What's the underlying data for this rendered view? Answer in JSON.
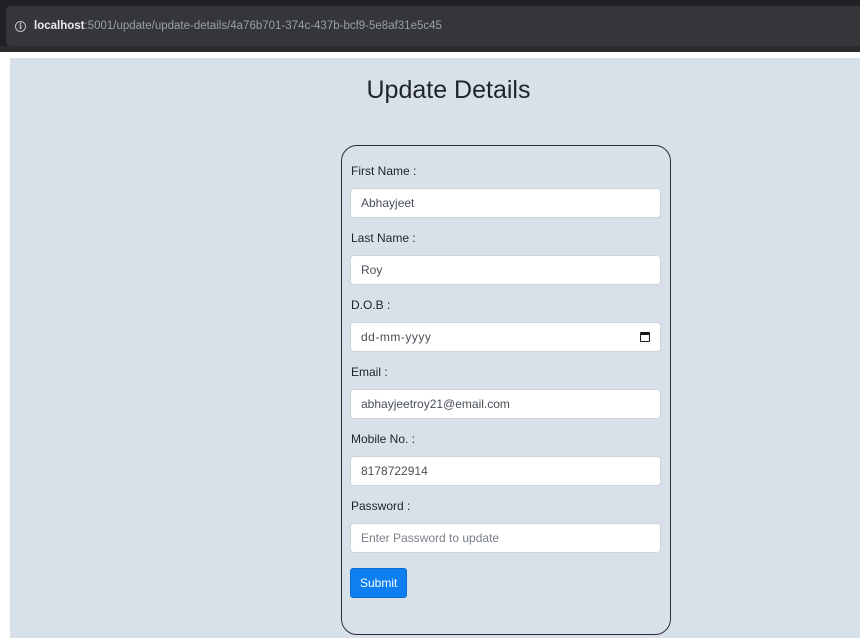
{
  "browser": {
    "url_host": "localhost",
    "url_path": ":5001/update/update-details/4a76b701-374c-437b-bcf9-5e8af31e5c45"
  },
  "page": {
    "title": "Update Details"
  },
  "form": {
    "first_name": {
      "label": "First Name :",
      "value": "Abhayjeet"
    },
    "last_name": {
      "label": "Last Name :",
      "value": "Roy"
    },
    "dob": {
      "label": "D.O.B :",
      "placeholder": "dd-mm-yyyy"
    },
    "email": {
      "label": "Email :",
      "value": "abhayjeetroy21@email.com"
    },
    "mobile": {
      "label": "Mobile No. :",
      "value": "8178722914"
    },
    "password": {
      "label": "Password :",
      "placeholder": "Enter Password to update"
    },
    "submit_label": "Submit"
  },
  "colors": {
    "page_background": "#d8e1ea",
    "primary_button": "#0d7ff0"
  }
}
